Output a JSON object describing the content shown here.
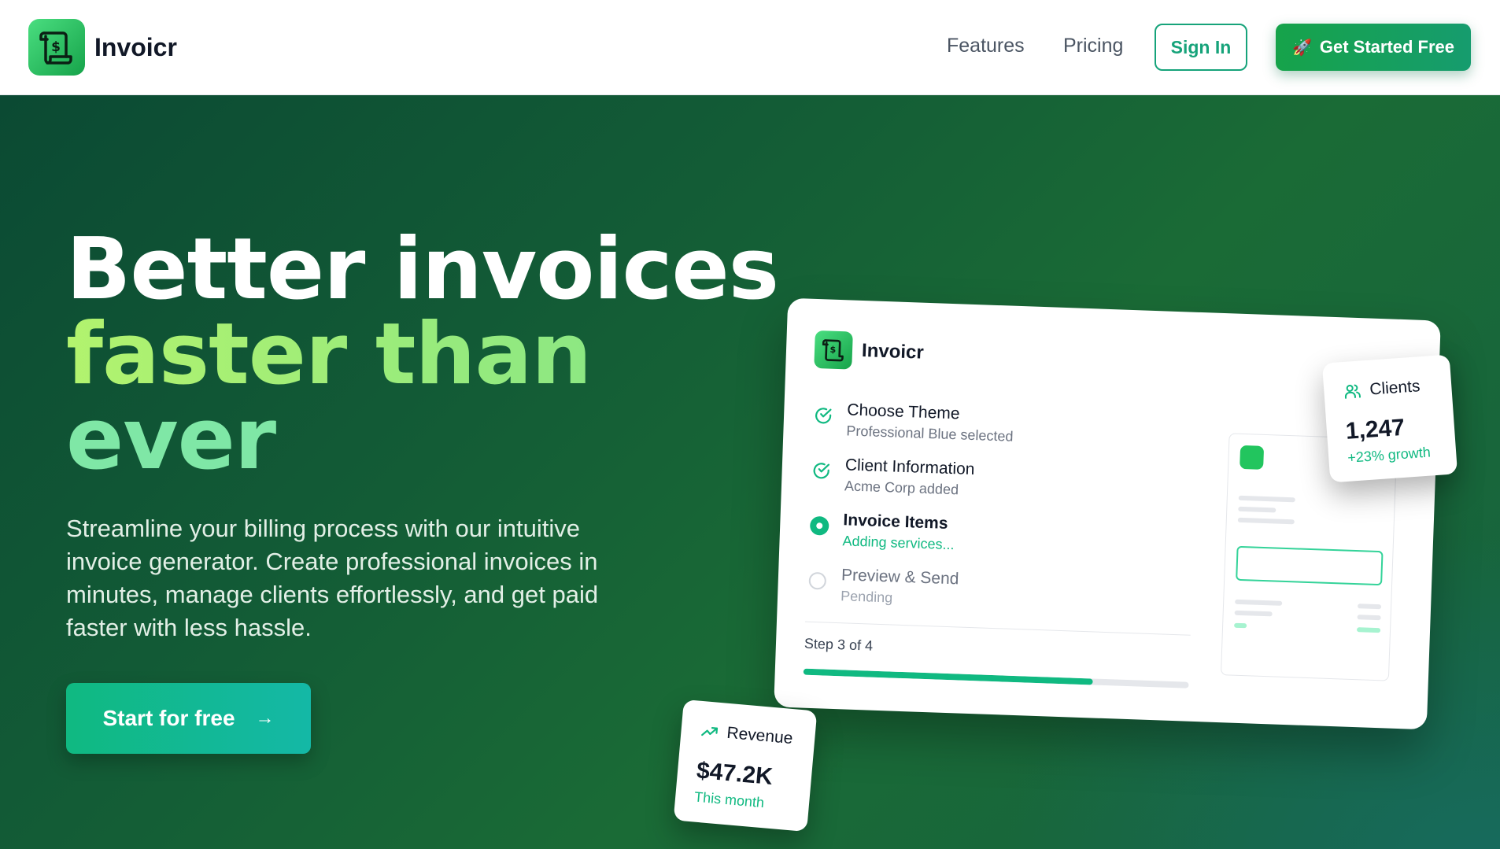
{
  "nav": {
    "brand": "Invoicr",
    "links": [
      "Features",
      "Pricing"
    ],
    "sign_in": "Sign In",
    "get_started": "Get Started Free"
  },
  "hero": {
    "headline_line1": "Better invoices",
    "headline_line2": "faster than",
    "headline_line3": "ever",
    "subtitle": "Streamline your billing process with our intuitive invoice generator. Create professional invoices in minutes, manage clients effortlessly, and get paid faster with less hassle.",
    "cta": "Start for free"
  },
  "mockup": {
    "brand": "Invoicr",
    "steps": [
      {
        "title": "Choose Theme",
        "sub": "Professional Blue selected",
        "state": "done"
      },
      {
        "title": "Client Information",
        "sub": "Acme Corp added",
        "state": "done"
      },
      {
        "title": "Invoice Items",
        "sub": "Adding services...",
        "state": "active"
      },
      {
        "title": "Preview & Send",
        "sub": "Pending",
        "state": "pending"
      }
    ],
    "step_count": "Step 3 of 4",
    "progress": 0.75
  },
  "clients_card": {
    "label": "Clients",
    "value": "1,247",
    "sub": "+23% growth"
  },
  "revenue_card": {
    "label": "Revenue",
    "value": "$47.2K",
    "sub": "This month"
  },
  "colors": {
    "accent": "#10b981",
    "brand_green": "#16a34a",
    "hero_bg": "#135c36",
    "headline_lime": "#a6f06b"
  }
}
